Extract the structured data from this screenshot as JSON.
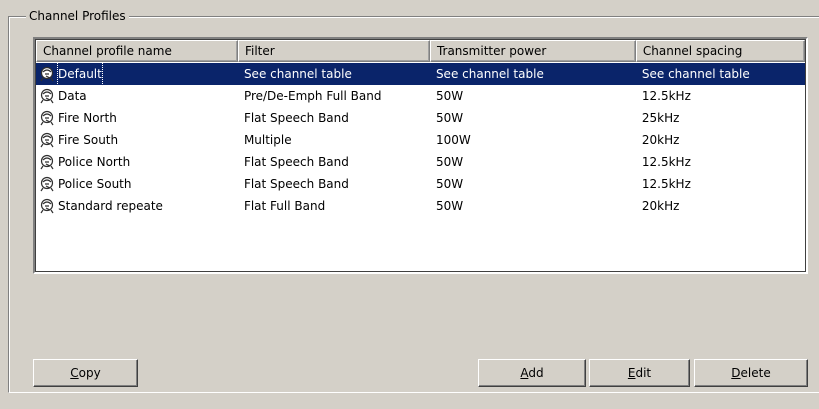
{
  "group": {
    "title": "Channel Profiles"
  },
  "columns": [
    "Channel profile name",
    "Filter",
    "Transmitter power",
    "Channel spacing"
  ],
  "rows": [
    {
      "name": "Default",
      "filter": "See channel table",
      "power": "See channel table",
      "spacing": "See channel table",
      "selected": true
    },
    {
      "name": "Data",
      "filter": "Pre/De-Emph Full Band",
      "power": "50W",
      "spacing": "12.5kHz"
    },
    {
      "name": "Fire North",
      "filter": "Flat Speech Band",
      "power": "50W",
      "spacing": "25kHz"
    },
    {
      "name": "Fire South",
      "filter": "Multiple",
      "power": "100W",
      "spacing": "20kHz"
    },
    {
      "name": "Police North",
      "filter": "Flat Speech Band",
      "power": "50W",
      "spacing": "12.5kHz"
    },
    {
      "name": "Police South",
      "filter": "Flat Speech Band",
      "power": "50W",
      "spacing": "12.5kHz"
    },
    {
      "name": "Standard repeate",
      "filter": "Flat Full Band",
      "power": "50W",
      "spacing": "20kHz"
    }
  ],
  "buttons": {
    "copy": {
      "label": "Copy",
      "mnemonic": "C"
    },
    "add": {
      "label": "Add",
      "mnemonic": "A"
    },
    "edit": {
      "label": "Edit",
      "mnemonic": "E"
    },
    "delete": {
      "label": "Delete",
      "mnemonic": "D"
    }
  },
  "icons": {
    "row_icon": "profile-icon"
  }
}
